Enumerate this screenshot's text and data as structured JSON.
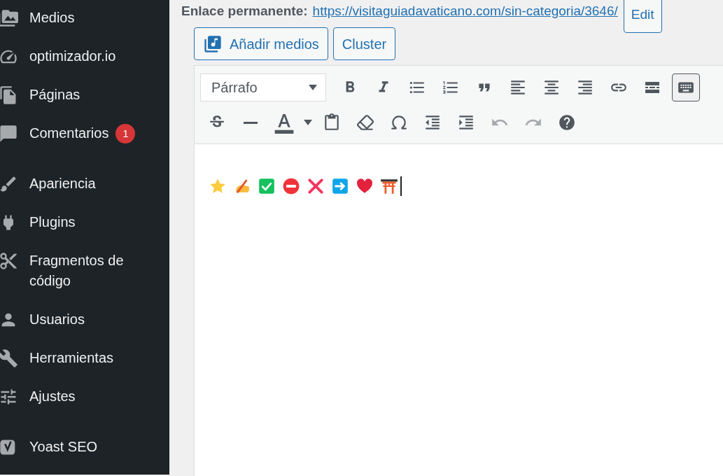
{
  "sidebar": {
    "groups": [
      [
        {
          "kind": "media",
          "label": "Medios"
        },
        {
          "kind": "gauge",
          "label": "optimizador.io"
        },
        {
          "kind": "pages",
          "label": "Páginas"
        },
        {
          "kind": "comments",
          "label": "Comentarios",
          "badge": "1"
        }
      ],
      [
        {
          "kind": "appearance",
          "label": "Apariencia"
        },
        {
          "kind": "plugins",
          "label": "Plugins"
        },
        {
          "kind": "snippets",
          "label": "Fragmentos de código"
        },
        {
          "kind": "users",
          "label": "Usuarios"
        },
        {
          "kind": "tools",
          "label": "Herramientas"
        },
        {
          "kind": "settings",
          "label": "Ajustes"
        }
      ],
      [
        {
          "kind": "yoast",
          "label": "Yoast SEO"
        }
      ]
    ]
  },
  "permalink": {
    "label": "Enlace permanente:",
    "url": "https://visitaguiadavaticano.com/sin-categoria/3646/",
    "edit_button": "Edit"
  },
  "media_buttons": [
    {
      "kind": "media",
      "label": "Añadir medios"
    },
    {
      "kind": "plain",
      "label": "Cluster"
    }
  ],
  "editor": {
    "format": "Párrafo",
    "toolbar_rows": [
      [
        {
          "kind": "bold",
          "active": false,
          "disabled": false
        },
        {
          "kind": "italic",
          "active": false,
          "disabled": false
        },
        {
          "kind": "bullets",
          "active": false,
          "disabled": false
        },
        {
          "kind": "numbers",
          "active": false,
          "disabled": false
        },
        {
          "kind": "quote",
          "active": false,
          "disabled": false
        },
        {
          "kind": "align-left",
          "active": false,
          "disabled": false
        },
        {
          "kind": "align-center",
          "active": false,
          "disabled": false
        },
        {
          "kind": "align-right",
          "active": false,
          "disabled": false
        },
        {
          "kind": "link",
          "active": false,
          "disabled": false
        },
        {
          "kind": "more",
          "active": false,
          "disabled": false
        },
        {
          "kind": "toolbar-toggle",
          "active": true,
          "disabled": false
        }
      ],
      [
        {
          "kind": "strike",
          "active": false,
          "disabled": false
        },
        {
          "kind": "hr",
          "active": false,
          "disabled": false
        },
        {
          "kind": "text-color",
          "active": false,
          "disabled": false
        },
        {
          "kind": "paste-text",
          "active": false,
          "disabled": false
        },
        {
          "kind": "clear",
          "active": false,
          "disabled": false
        },
        {
          "kind": "omega",
          "active": false,
          "disabled": false
        },
        {
          "kind": "outdent",
          "active": false,
          "disabled": false
        },
        {
          "kind": "indent",
          "active": false,
          "disabled": false
        },
        {
          "kind": "undo",
          "active": false,
          "disabled": true
        },
        {
          "kind": "redo",
          "active": false,
          "disabled": true
        },
        {
          "kind": "help",
          "active": false,
          "disabled": false
        }
      ]
    ],
    "content": [
      {
        "kind": "star"
      },
      {
        "kind": "writing-hand"
      },
      {
        "kind": "check"
      },
      {
        "kind": "no-entry"
      },
      {
        "kind": "cross"
      },
      {
        "kind": "arrow"
      },
      {
        "kind": "heart"
      },
      {
        "kind": "torii"
      }
    ]
  }
}
